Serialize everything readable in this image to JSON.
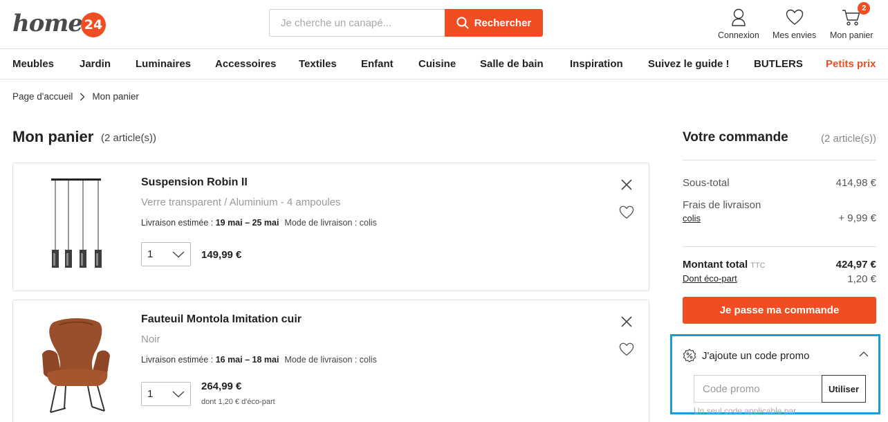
{
  "brand": {
    "name": "home",
    "badge": "24",
    "accent": "#f04d23"
  },
  "search": {
    "placeholder": "Je cherche un canapé...",
    "button_label": "Rechercher"
  },
  "header_actions": {
    "login": "Connexion",
    "wishlist": "Mes envies",
    "cart": "Mon panier",
    "cart_count": "2"
  },
  "nav": {
    "items": [
      "Meubles",
      "Jardin",
      "Luminaires",
      "Accessoires",
      "Textiles",
      "Enfant",
      "Cuisine",
      "Salle de bain",
      "Inspiration",
      "Suivez le guide !",
      "BUTLERS"
    ],
    "promo_item": "Petits prix"
  },
  "breadcrumb": {
    "home": "Page d'accueil",
    "current": "Mon panier"
  },
  "cart": {
    "title": "Mon panier",
    "count_label": "(2 article(s))",
    "items": [
      {
        "name": "Suspension Robin II",
        "variant": "Verre transparent / Aluminium - 4 ampoules",
        "delivery_prefix": "Livraison estimée : ",
        "delivery_dates": "19 mai – 25 mai",
        "delivery_mode": "Mode de livraison : colis",
        "quantity": "1",
        "price": "149,99 €",
        "eco": ""
      },
      {
        "name": "Fauteuil Montola Imitation cuir",
        "variant": "Noir",
        "delivery_prefix": "Livraison estimée : ",
        "delivery_dates": "16 mai – 18 mai",
        "delivery_mode": "Mode de livraison : colis",
        "quantity": "1",
        "price": "264,99 €",
        "eco": "dont 1,20 € d'éco-part"
      }
    ]
  },
  "summary": {
    "title": "Votre commande",
    "count_label": "(2 article(s))",
    "subtotal_label": "Sous-total",
    "subtotal_value": "414,98 €",
    "shipping_label": "Frais de livraison",
    "shipping_link": "colis",
    "shipping_value": "+ 9,99 €",
    "total_label": "Montant total",
    "total_ttc": "TTC",
    "total_value": "424,97 €",
    "eco_link": "Dont éco-part",
    "eco_value": "1,20 €",
    "checkout_label": "Je passe ma commande"
  },
  "promo": {
    "heading": "J'ajoute un code promo",
    "placeholder": "Code promo",
    "button_label": "Utiliser",
    "note": "Un seul code applicable par"
  }
}
